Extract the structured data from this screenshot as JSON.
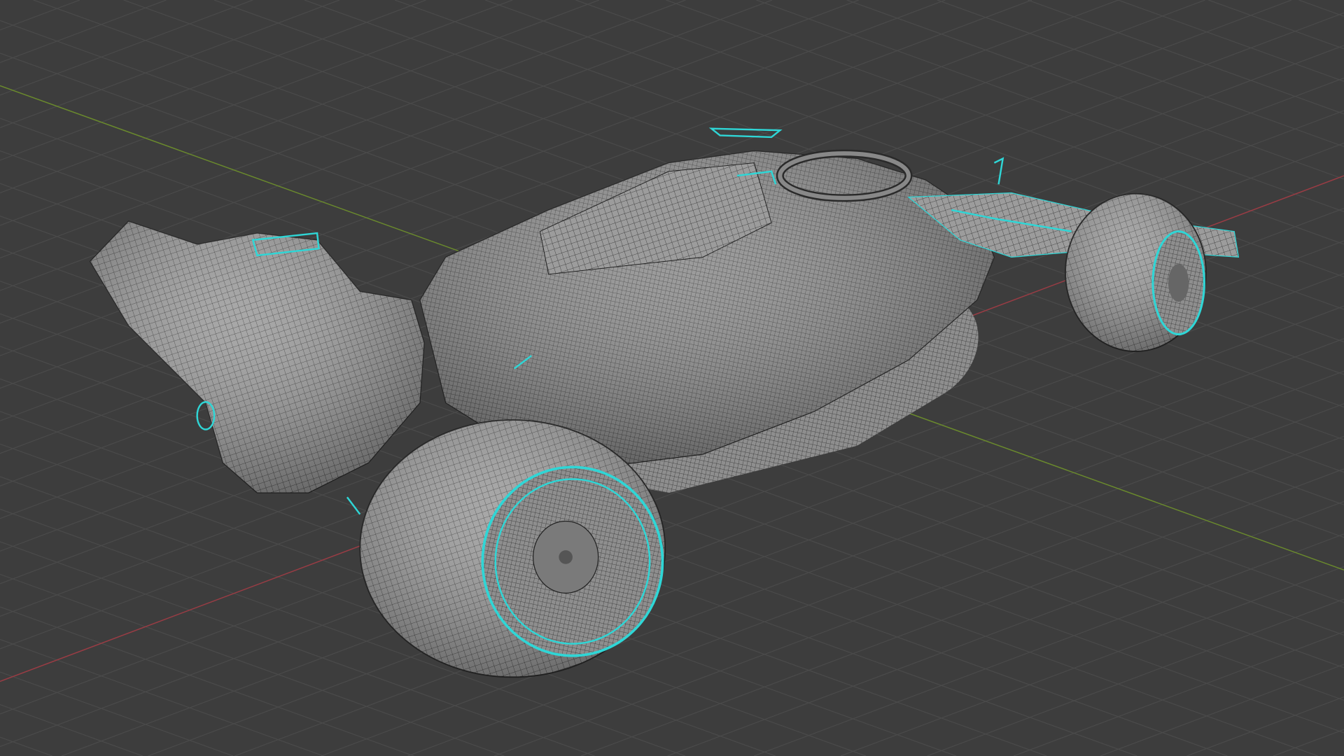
{
  "viewport": {
    "mode": "3d-viewport-wireframe-overlay",
    "colors": {
      "background": "#3d3d3d",
      "grid": "#4a4a4a",
      "x_axis": "#9a3c44",
      "y_axis": "#6a8a2c",
      "mesh_surface": "#9a9a9a",
      "mesh_wire": "#2a2a2a",
      "selected_edges": "#2fd6d6"
    }
  },
  "scene": {
    "object": "f1-car-model"
  }
}
